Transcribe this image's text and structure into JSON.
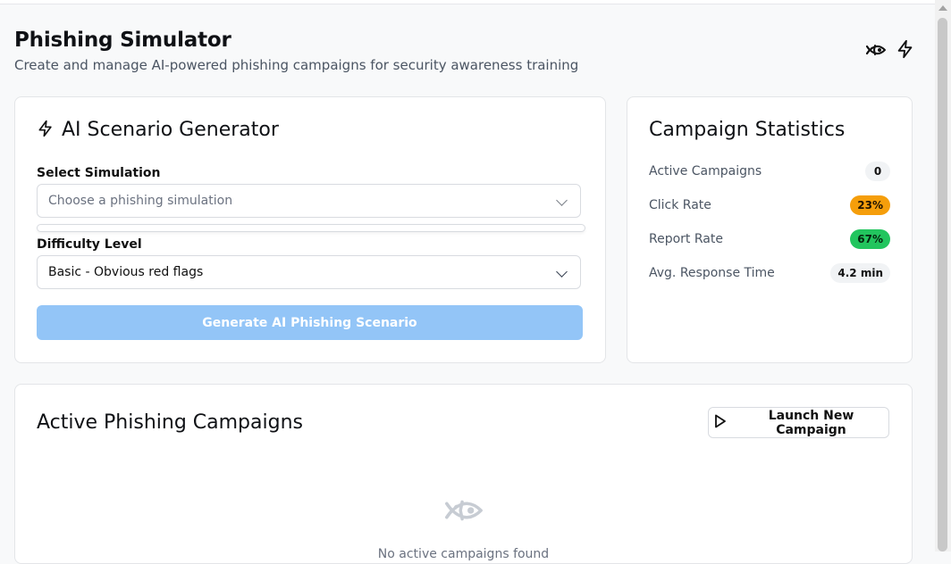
{
  "header": {
    "title": "Phishing Simulator",
    "subtitle": "Create and manage AI-powered phishing campaigns for security awareness training",
    "icons": [
      "fish-icon",
      "lightning-icon"
    ]
  },
  "generator": {
    "title": "AI Scenario Generator",
    "icon": "lightning-icon",
    "simulation_label": "Select Simulation",
    "simulation_placeholder": "Choose a phishing simulation",
    "difficulty_label": "Difficulty Level",
    "difficulty_value": "Basic - Obvious red flags",
    "generate_button": "Generate AI Phishing Scenario"
  },
  "stats": {
    "title": "Campaign Statistics",
    "rows": [
      {
        "label": "Active Campaigns",
        "value": "0",
        "style": "gray"
      },
      {
        "label": "Click Rate",
        "value": "23%",
        "style": "orange",
        "color": "#f59e0b"
      },
      {
        "label": "Report Rate",
        "value": "67%",
        "style": "green",
        "color": "#22c55e"
      },
      {
        "label": "Avg. Response Time",
        "value": "4.2 min",
        "style": "gray"
      }
    ]
  },
  "campaigns": {
    "title": "Active Phishing Campaigns",
    "launch_button": "Launch New Campaign",
    "launch_icon": "play-icon",
    "empty_icon": "fish-icon",
    "empty_text": "No active campaigns found"
  },
  "colors": {
    "accent_disabled": "#93c5f7",
    "orange": "#f59e0b",
    "green": "#22c55e"
  }
}
